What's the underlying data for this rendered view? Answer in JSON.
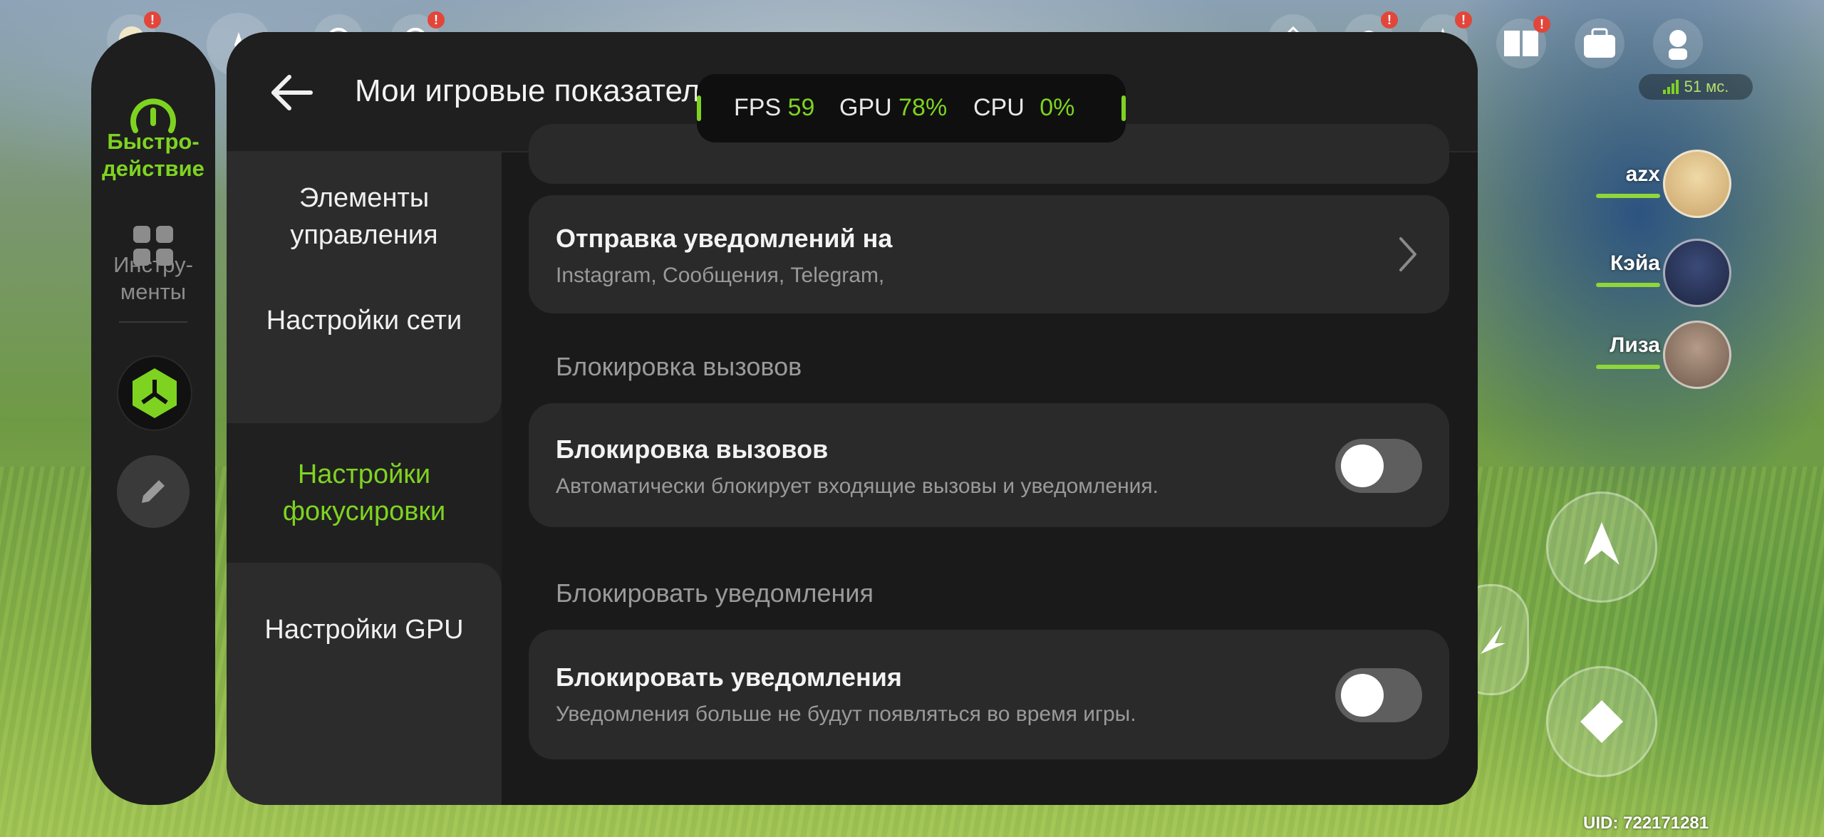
{
  "overlay": {
    "fps_label": "FPS",
    "fps_value": "59",
    "gpu_label": "GPU",
    "gpu_value": "78%",
    "cpu_label": "CPU",
    "cpu_value": "0%"
  },
  "rail": {
    "performance_label": "Быстро-\nдействие",
    "tools_label": "Инстру-\nменты"
  },
  "header": {
    "title": "Мои игровые показатели"
  },
  "nav": {
    "items": [
      {
        "label": "Элементы\nуправления"
      },
      {
        "label": "Настройки сети"
      },
      {
        "label": "Настройки\nфокусировки"
      },
      {
        "label": "Настройки GPU"
      }
    ]
  },
  "content": {
    "notifications_to": {
      "title": "Отправка уведомлений на",
      "subtitle": "Instagram, Сообщения, Telegram,"
    },
    "call_block_section": "Блокировка вызовов",
    "call_block": {
      "title": "Блокировка вызовов",
      "subtitle": "Автоматически блокирует входящие вызовы и уведомления.",
      "enabled": false
    },
    "notif_block_section": "Блокировать уведомления",
    "notif_block": {
      "title": "Блокировать уведомления",
      "subtitle": "Уведомления больше не будут появляться во время игры.",
      "enabled": false
    }
  },
  "game_hud": {
    "ping": "51 мс.",
    "party": [
      {
        "name": "azx"
      },
      {
        "name": "Кэйа"
      },
      {
        "name": "Лиза"
      }
    ],
    "uid": "UID: 722171281",
    "badge": "!"
  },
  "colors": {
    "accent": "#7ed321",
    "panel": "#202020",
    "card": "#2a2a2a"
  }
}
